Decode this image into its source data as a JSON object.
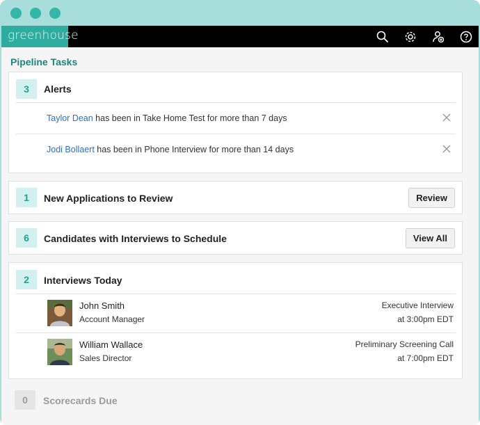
{
  "app": {
    "logo_text": "greenhouse"
  },
  "nav_icons": [
    "search-icon",
    "gear-icon",
    "user-add-icon",
    "help-icon"
  ],
  "section_title": "Pipeline Tasks",
  "alerts": {
    "count": "3",
    "title": "Alerts",
    "items": [
      {
        "name": "Taylor Dean",
        "text": " has been in Take Home Test for more than 7 days"
      },
      {
        "name": "Jodi Bollaert",
        "text": " has been in Phone Interview for more than 14 days"
      }
    ]
  },
  "new_applications": {
    "count": "1",
    "title": "New Applications to Review",
    "button": "Review"
  },
  "interviews_to_schedule": {
    "count": "6",
    "title": "Candidates with Interviews to Schedule",
    "button": "View All"
  },
  "interviews_today": {
    "count": "2",
    "title": "Interviews Today",
    "items": [
      {
        "name": "John Smith",
        "role": "Account Manager",
        "type": "Executive Interview",
        "time": "at 3:00pm EDT"
      },
      {
        "name": "William Wallace",
        "role": "Sales Director",
        "type": "Preliminary Screening Call",
        "time": "at 7:00pm EDT"
      }
    ]
  },
  "scorecards_due": {
    "count": "0",
    "title": "Scorecards Due"
  },
  "colors": {
    "accent": "#2eaca0",
    "frame": "#a7dedb",
    "link": "#2f6fbf",
    "badge_bg": "#d2f0ee"
  }
}
